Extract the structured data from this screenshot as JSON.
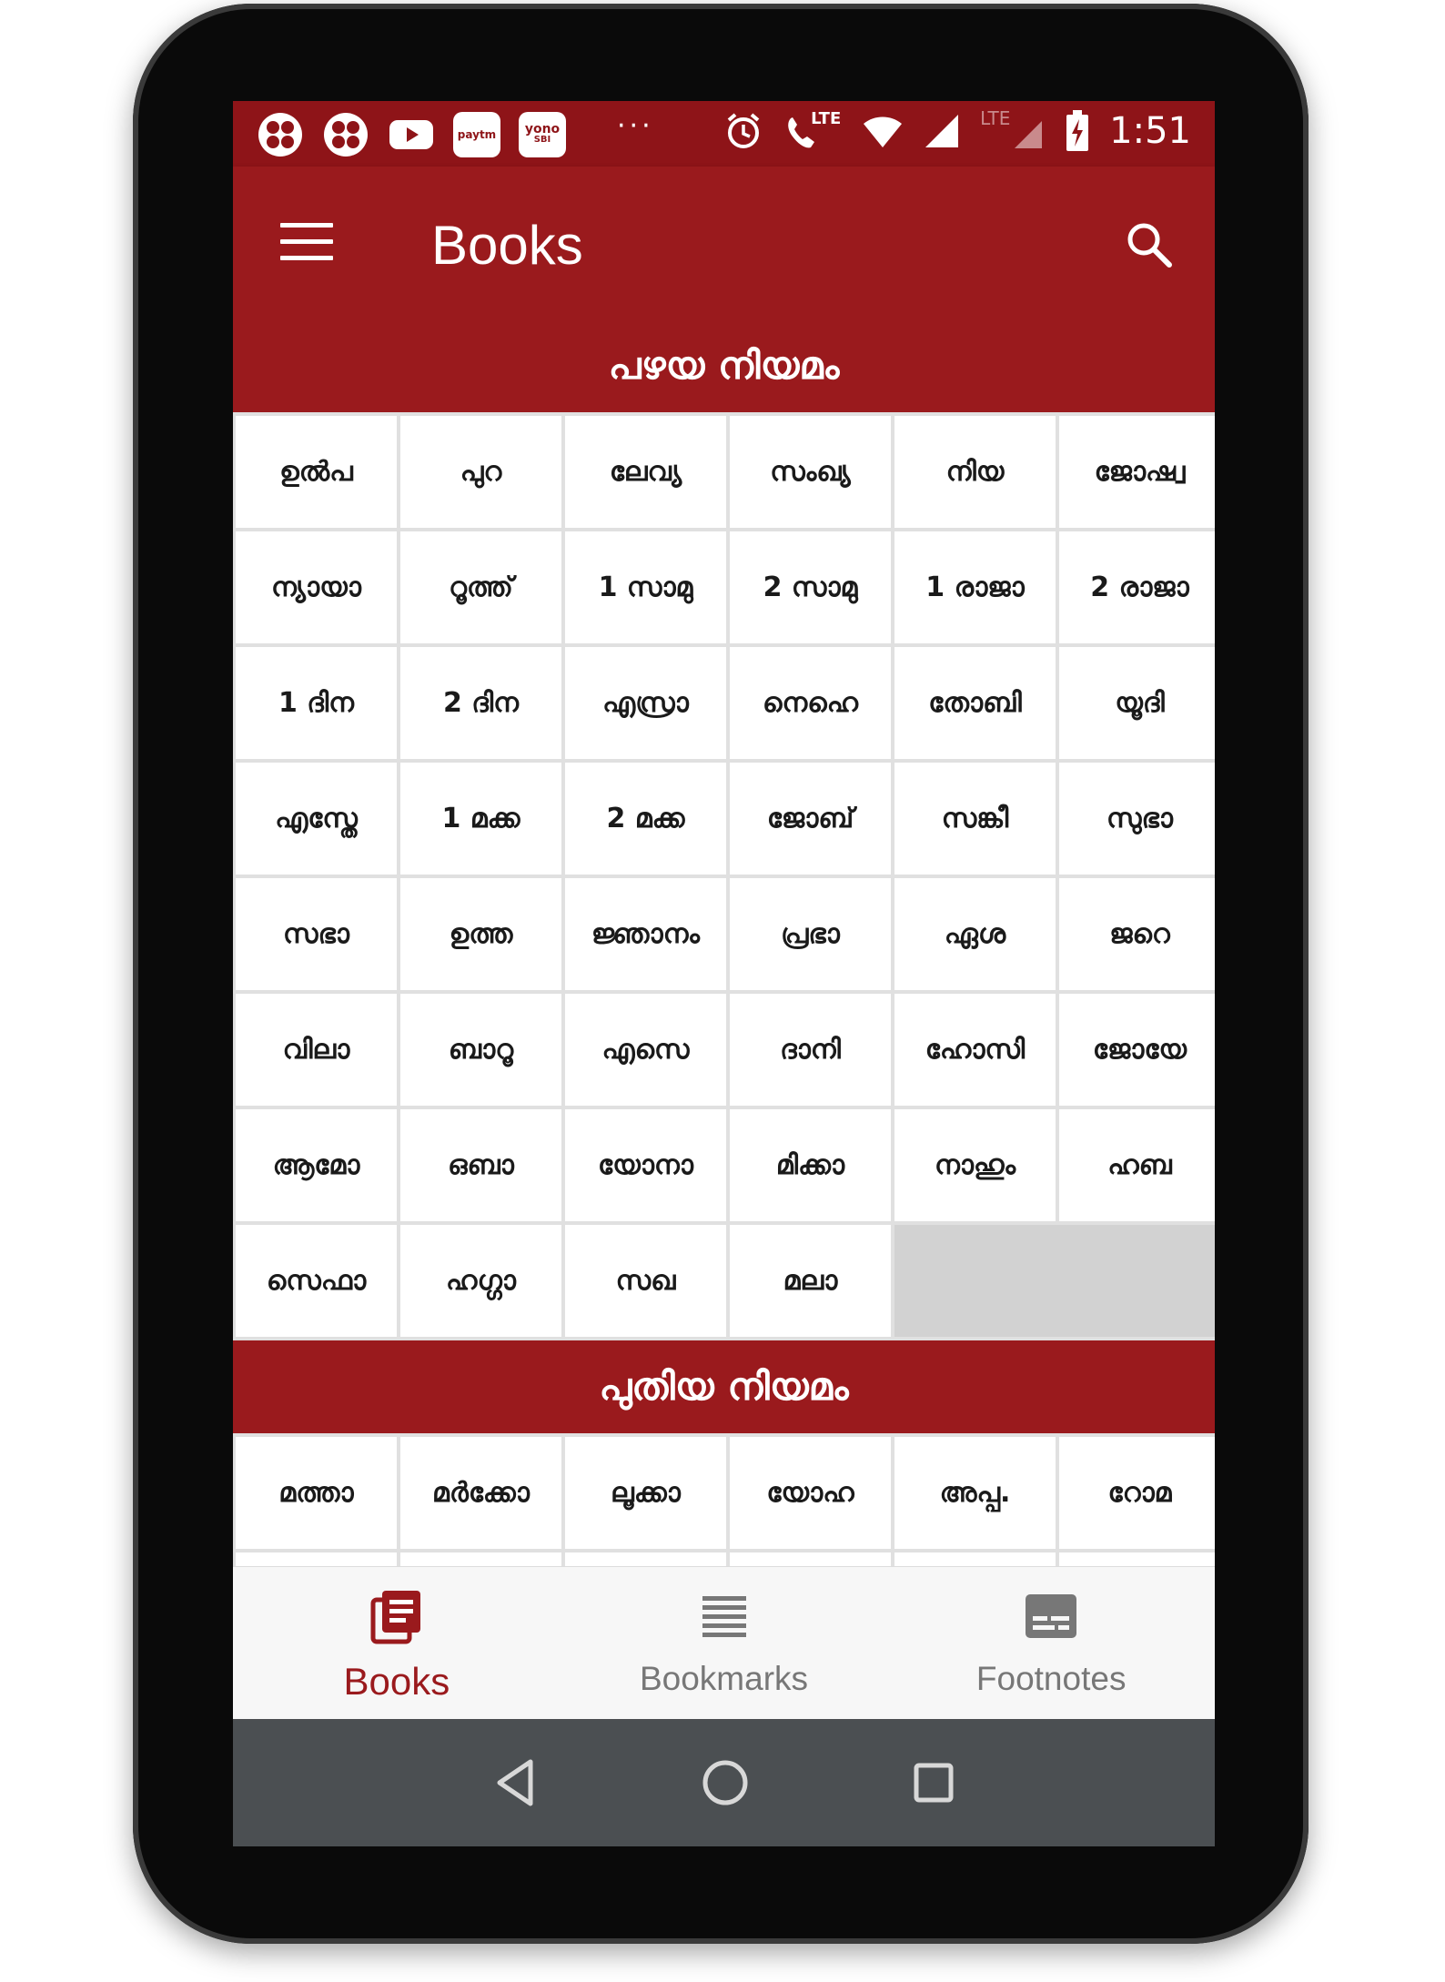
{
  "status_bar": {
    "left_icons": [
      "app-icon",
      "app-icon",
      "youtube-icon",
      "paytm-icon",
      "yono-sbi-icon"
    ],
    "paytm_label": "paytm",
    "yono_label": "yono",
    "yono_sub": "SBI",
    "overflow": "···",
    "lte1": "LTE",
    "lte2": "LTE",
    "time": "1:51"
  },
  "app_bar": {
    "title": "Books"
  },
  "sections": [
    {
      "title": "പഴയ നിയമം",
      "books": [
        "ഉൽപ",
        "പുറ",
        "ലേവ്യ",
        "സംഖ്യ",
        "നിയ",
        "ജോഷ്വ",
        "ന്യായാ",
        "റൂത്ത്",
        "1 സാമു",
        "2 സാമു",
        "1 രാജാ",
        "2 രാജാ",
        "1 ദിന",
        "2 ദിന",
        "എസ്രാ",
        "നെഹെ",
        "തോബി",
        "യൂദി",
        "എസ്തേ",
        "1 മക്ക",
        "2 മക്ക",
        "ജോബ്",
        "സങ്കീ",
        "സുഭാ",
        "സഭാ",
        "ഉത്ത",
        "ജ്ഞാനം",
        "പ്രഭാ",
        "ഏശ",
        "ജറെ",
        "വിലാ",
        "ബാറൂ",
        "എസെ",
        "ദാനി",
        "ഹോസി",
        "ജോയേ",
        "ആമോ",
        "ഒബാ",
        "യോനാ",
        "മിക്കാ",
        "നാഹും",
        "ഹബ",
        "സെഫാ",
        "ഹഗ്ഗാ",
        "സഖ",
        "മലാ"
      ]
    },
    {
      "title": "പുതിയ നിയമം",
      "books": [
        "മത്താ",
        "മർക്കോ",
        "ലൂക്കാ",
        "യോഹ",
        "അപ്പ.",
        "റോമ"
      ]
    }
  ],
  "bottom_nav": [
    {
      "label": "Books",
      "icon": "books-icon",
      "active": true
    },
    {
      "label": "Bookmarks",
      "icon": "bookmarks-icon",
      "active": false
    },
    {
      "label": "Footnotes",
      "icon": "footnotes-icon",
      "active": false
    }
  ],
  "colors": {
    "primary": "#9a1a1d",
    "status_bar": "#8e1418",
    "grid_bg": "#e0e0e0",
    "empty_cell": "#d2d2d2",
    "system_nav": "#4b4f52"
  }
}
